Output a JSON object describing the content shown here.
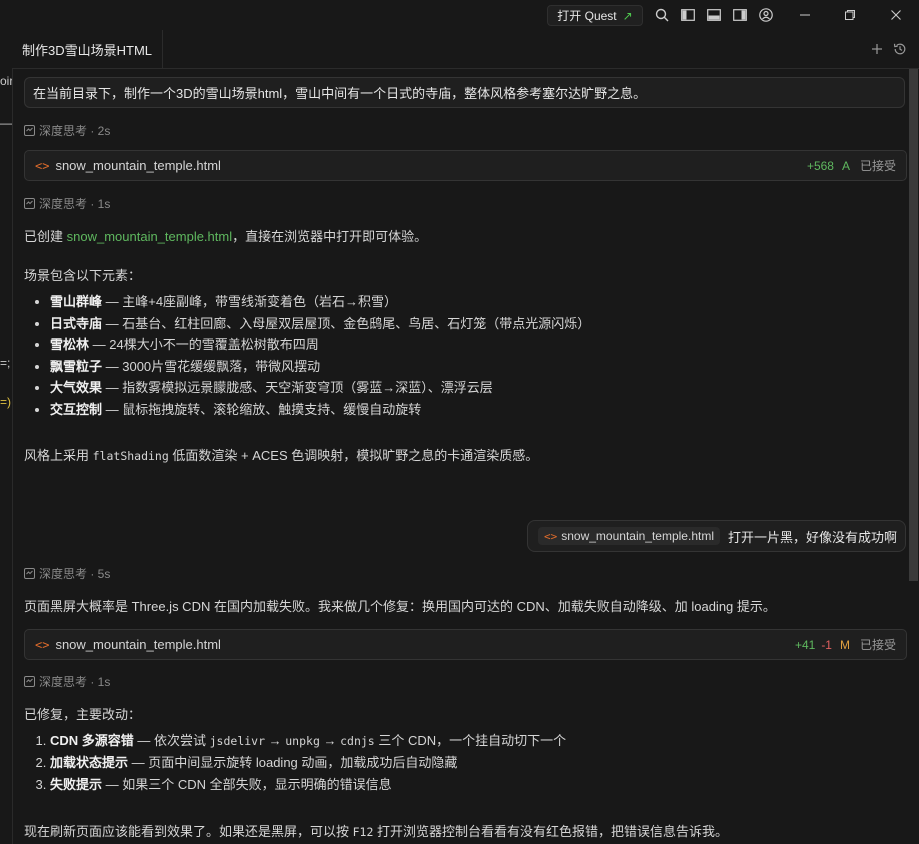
{
  "titlebar": {
    "quest_label": "打开 Quest",
    "icons": [
      "search-icon",
      "layout-sidebar-left-icon",
      "layout-panel-icon",
      "layout-sidebar-right-icon",
      "account-icon"
    ],
    "window_controls": [
      "minimize-icon",
      "restore-icon",
      "close-icon"
    ]
  },
  "left_strip": {
    "fragments": [
      "oir",
      "—",
      "=;",
      "=)"
    ]
  },
  "tab": {
    "title": "制作3D雪山场景HTML"
  },
  "chat": {
    "user_prompt": "在当前目录下，制作一个3D的雪山场景html，雪山中间有一个日式的寺庙，整体风格参考塞尔达旷野之息。",
    "think1": "深度思考 · 2s",
    "file1": {
      "name": "snow_mountain_temple.html",
      "added": "+568",
      "status": "A",
      "state": "已接受"
    },
    "think2": "深度思考 · 1s",
    "created_prefix": "已创建 ",
    "created_link": "snow_mountain_temple.html",
    "created_suffix": "，直接在浏览器中打开即可体验。",
    "scene_intro": "场景包含以下元素：",
    "features": [
      {
        "title": "雪山群峰",
        "desc": " — 主峰+4座副峰，带雪线渐变着色（岩石→积雪）"
      },
      {
        "title": "日式寺庙",
        "desc": " — 石基台、红柱回廊、入母屋双层屋顶、金色鸱尾、鸟居、石灯笼（带点光源闪烁）"
      },
      {
        "title": "雪松林",
        "desc": " — 24棵大小不一的雪覆盖松树散布四周"
      },
      {
        "title": "飘雪粒子",
        "desc": " — 3000片雪花缓缓飘落，带微风摆动"
      },
      {
        "title": "大气效果",
        "desc": " — 指数雾模拟远景朦胧感、天空渐变穹顶（雾蓝→深蓝）、漂浮云层"
      },
      {
        "title": "交互控制",
        "desc": " — 鼠标拖拽旋转、滚轮缩放、触摸支持、缓慢自动旋转"
      }
    ],
    "style_prefix": "风格上采用 ",
    "style_code": "flatShading",
    "style_suffix": " 低面数渲染 + ACES 色调映射，模拟旷野之息的卡通渲染质感。",
    "user_followup": {
      "chip": "snow_mountain_temple.html",
      "text": "打开一片黑，好像没有成功啊"
    },
    "think3": "深度思考 · 5s",
    "diagnosis": "页面黑屏大概率是 Three.js CDN 在国内加载失败。我来做几个修复：换用国内可达的 CDN、加载失败自动降级、加 loading 提示。",
    "file2": {
      "name": "snow_mountain_temple.html",
      "added": "+41",
      "removed": "-1",
      "status": "M",
      "state": "已接受"
    },
    "think4": "深度思考 · 1s",
    "fixed_intro": "已修复，主要改动：",
    "fix1": {
      "title": "CDN 多源容错",
      "p1": " — 依次尝试 ",
      "c1": "jsdelivr",
      "a1": " → ",
      "c2": "unpkg",
      "a2": " → ",
      "c3": "cdnjs",
      "p2": " 三个 CDN，一个挂自动切下一个"
    },
    "fix2": {
      "title": "加载状态提示",
      "desc": " — 页面中间显示旋转 loading 动画，加载成功后自动隐藏"
    },
    "fix3": {
      "title": "失败提示",
      "desc": " — 如果三个 CDN 全部失败，显示明确的错误信息"
    },
    "final_prefix": "现在刷新页面应该能看到效果了。如果还是黑屏，可以按 ",
    "final_code": "F12",
    "final_suffix": " 打开浏览器控制台看看有没有红色报错，把错误信息告诉我。"
  }
}
